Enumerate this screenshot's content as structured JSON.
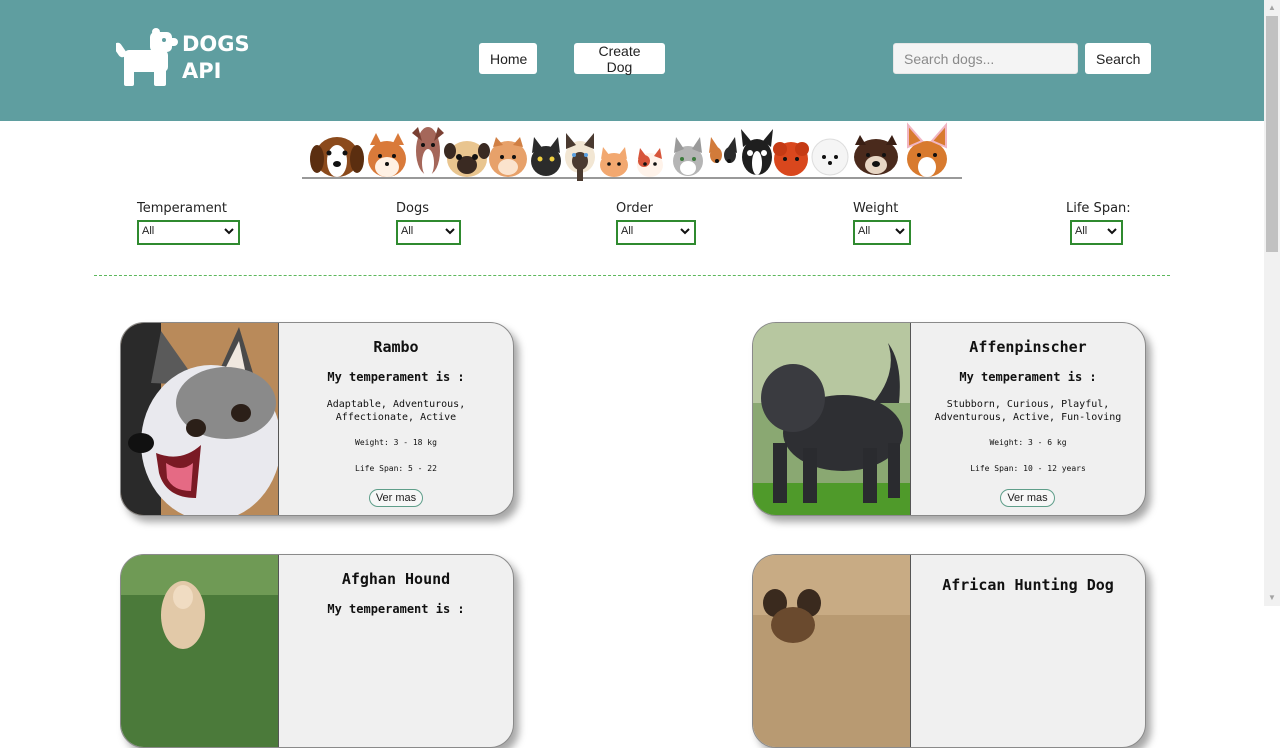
{
  "header": {
    "logo_line1": "DOGS",
    "logo_line2": "API",
    "nav": {
      "home": "Home",
      "create": "Create Dog"
    },
    "search": {
      "placeholder": "Search dogs...",
      "button": "Search"
    }
  },
  "filters": {
    "temperament": {
      "label": "Temperament",
      "value": "All"
    },
    "dogs": {
      "label": "Dogs",
      "value": "All"
    },
    "order": {
      "label": "Order",
      "value": "All"
    },
    "weight": {
      "label": "Weight",
      "value": "All"
    },
    "life_span": {
      "label": "Life Span:",
      "value": "All"
    }
  },
  "cards": [
    {
      "name": "Rambo",
      "temp_title": "My temperament is :",
      "temperament": "Adaptable, Adventurous, Affectionate, Active",
      "weight": "Weight: 3 - 18 kg",
      "life": "Life Span: 5 - 22",
      "button": "Ver mas"
    },
    {
      "name": "Affenpinscher",
      "temp_title": "My temperament is :",
      "temperament": "Stubborn, Curious, Playful, Adventurous, Active, Fun-loving",
      "weight": "Weight: 3 - 6 kg",
      "life": "Life Span: 10 - 12 years",
      "button": "Ver mas"
    },
    {
      "name": "Afghan Hound",
      "temp_title": "My temperament is :"
    },
    {
      "name": "African Hunting Dog"
    }
  ],
  "colors": {
    "header_bg": "#5f9ea0",
    "select_border": "#2f8a2f",
    "divider": "#5cb85c",
    "card_bg": "#f0f0f0"
  }
}
